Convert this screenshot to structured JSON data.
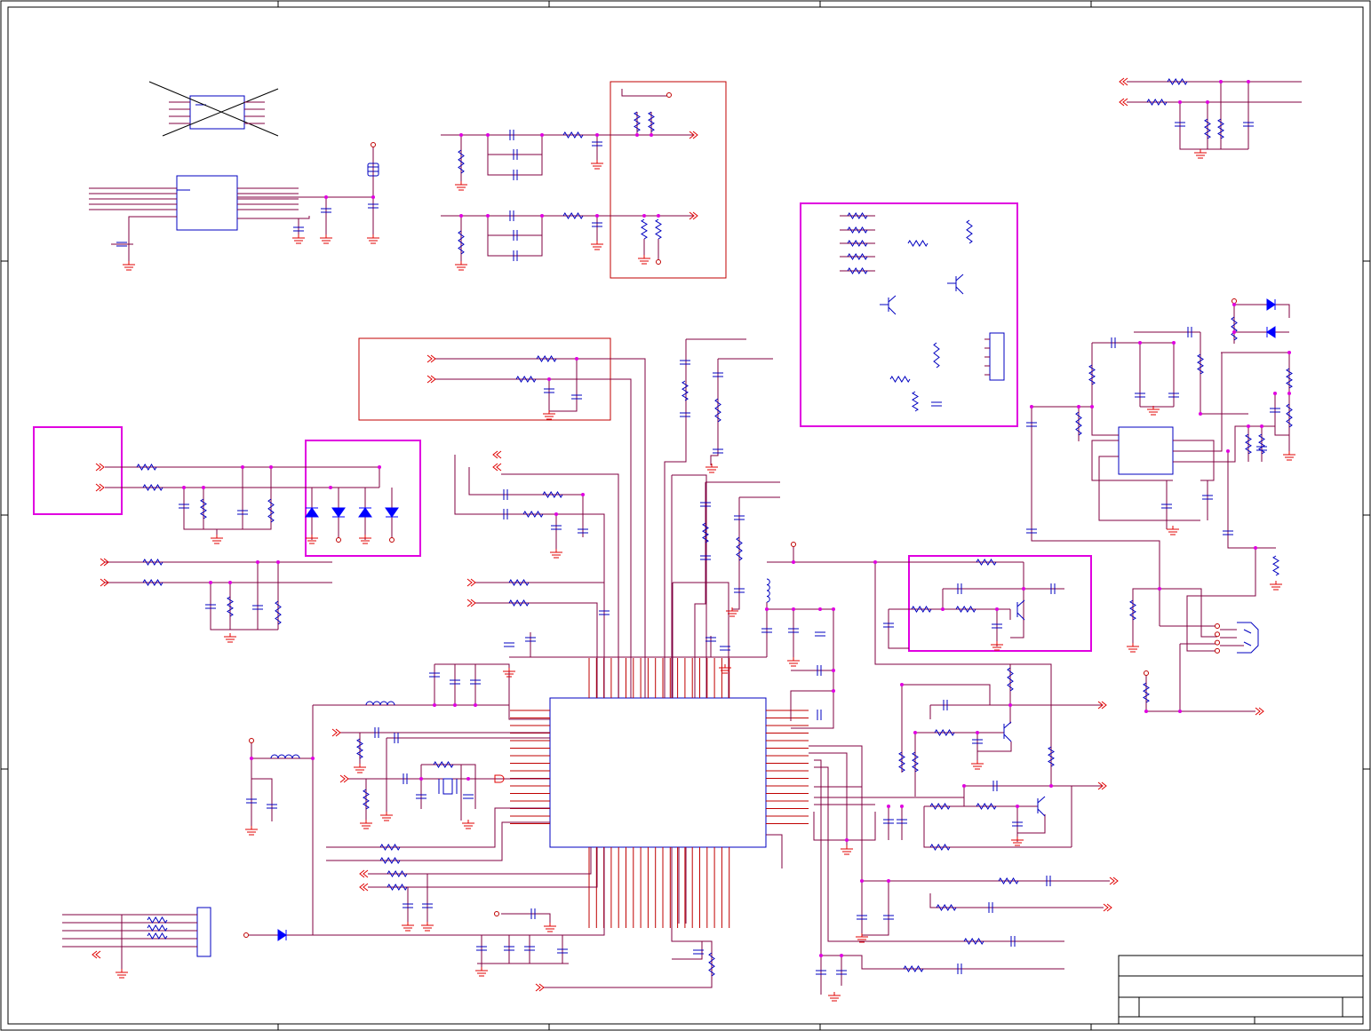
{
  "sheet": {
    "title_block_text": [],
    "zone_labels": []
  },
  "colors": {
    "background": "#ffffff",
    "border": "#000000",
    "wire": "#800040",
    "component": "#0000c0",
    "power_ground": "#e00000",
    "junction": "#e000e0",
    "section_box_magenta": "#e000e0",
    "section_box_red": "#c00000",
    "diode_fill": "#0000ff"
  }
}
